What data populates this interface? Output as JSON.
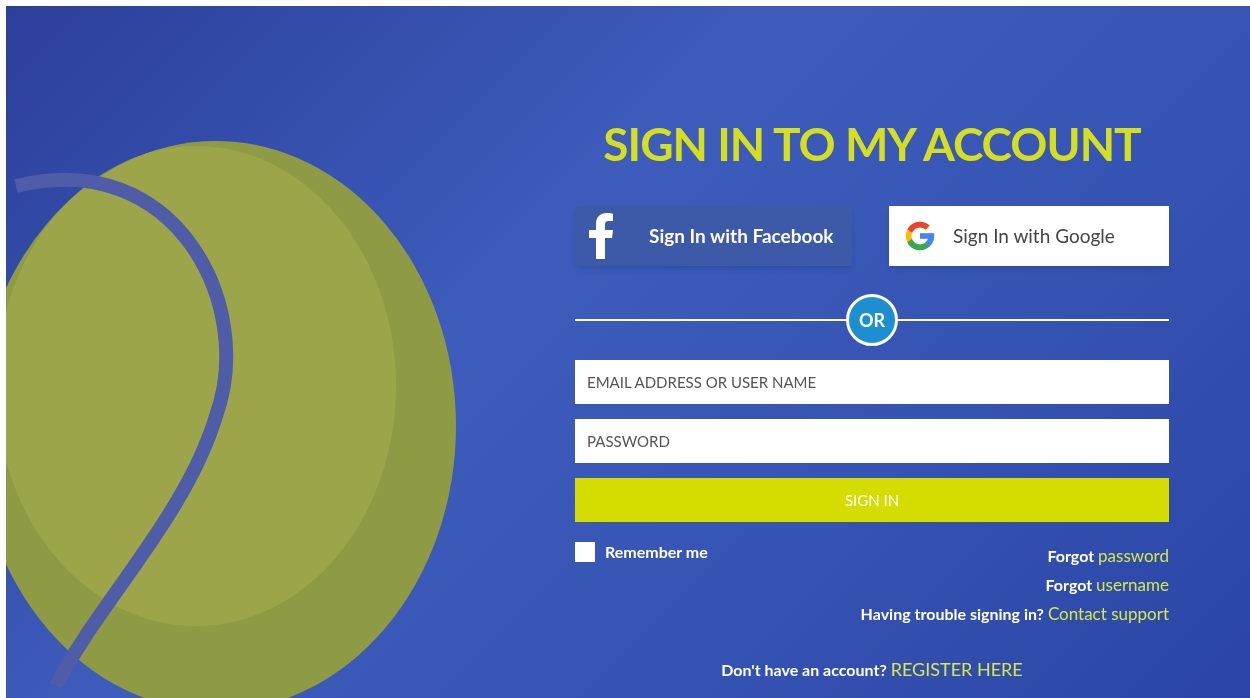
{
  "title": "SIGN IN TO MY ACCOUNT",
  "social_buttons": [
    {
      "kind": "facebook",
      "label": "Sign In with Facebook"
    },
    {
      "kind": "google",
      "label": "Sign In with Google"
    }
  ],
  "divider": {
    "label": "OR"
  },
  "fields": [
    {
      "placeholder": "EMAIL ADDRESS OR USER NAME"
    },
    {
      "placeholder": "PASSWORD"
    }
  ],
  "submit": {
    "label": "SIGN IN"
  },
  "remember": {
    "label": "Remember me",
    "checked": false
  },
  "help_links": [
    {
      "text": "Forgot",
      "link": "password"
    },
    {
      "text": "Forgot",
      "link": "username"
    },
    {
      "text": "Having trouble signing in?",
      "link": "Contact support"
    }
  ],
  "register": {
    "text": "Don't have an account?",
    "link": "REGISTER HERE"
  }
}
